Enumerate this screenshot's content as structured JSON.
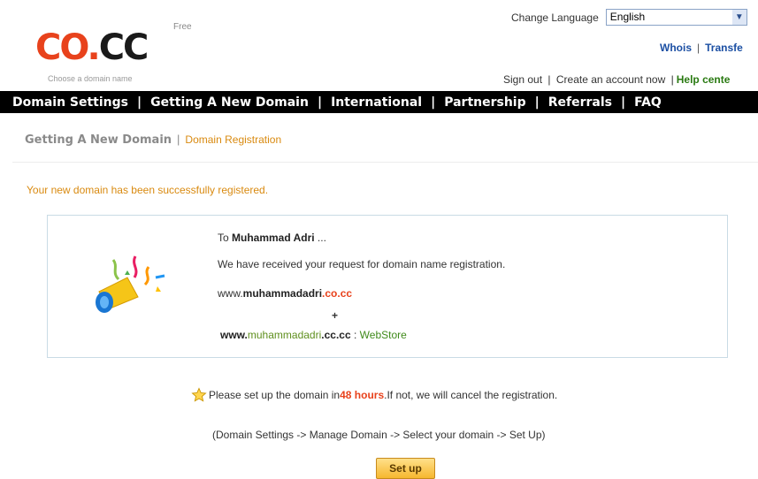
{
  "header": {
    "logo_free": "Free",
    "logo_co": "CO",
    "logo_dot": ".",
    "logo_cc": "CC",
    "logo_tagline": "Choose a domain name",
    "language_label": "Change Language",
    "language_value": "English",
    "toplinks": {
      "whois": "Whois",
      "sep": "|",
      "transfer": "Transfe"
    },
    "userlinks": {
      "sign_out": "Sign out",
      "sep1": "|",
      "create_account": "Create an account now",
      "sep2": "|",
      "help_center": "Help cente"
    }
  },
  "nav": {
    "items": [
      "Domain Settings",
      "Getting A New Domain",
      "International",
      "Partnership",
      "Referrals",
      "FAQ"
    ],
    "sep": "|"
  },
  "breadcrumb": {
    "parent": "Getting A New Domain",
    "sep": "|",
    "current": "Domain Registration"
  },
  "success_message": "Your new domain has been successfully registered.",
  "infobox": {
    "greeting_prefix": "To ",
    "greeting_name": "Muhammad Adri",
    "greeting_suffix": " ...",
    "request_text": "We have received your request for domain name registration.",
    "domain1_prefix": "www.",
    "domain1_name": "muhammadadri",
    "domain1_tld": ".co.cc",
    "plus": "+",
    "domain2_prefix": "www.",
    "domain2_name": "muhammadadri",
    "domain2_tld": ".cc.cc",
    "domain2_sep": " : ",
    "domain2_label": "WebStore"
  },
  "notice": {
    "prefix": "Please set up the domain in ",
    "hours": "48 hours",
    "suffix": ".If not, we will cancel the registration."
  },
  "path_hint": "(Domain Settings -> Manage Domain -> Select your domain -> Set Up)",
  "setup_button": "Set up",
  "colors": {
    "brand_red": "#e8421c",
    "nav_bg": "#000000",
    "accent_orange": "#d98a10",
    "link_blue": "#1b4fa3",
    "help_green": "#2a7a12"
  }
}
